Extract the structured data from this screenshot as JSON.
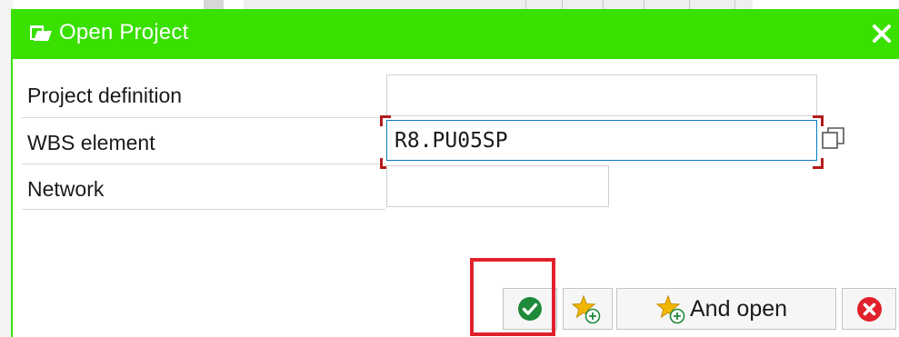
{
  "dialog": {
    "title": "Open Project",
    "title_icon": "open-folder-icon",
    "close_icon": "close-icon"
  },
  "form": {
    "project_definition": {
      "label": "Project definition",
      "value": ""
    },
    "wbs_element": {
      "label": "WBS element",
      "value": "R8.PU05SP"
    },
    "network": {
      "label": "Network",
      "value": ""
    }
  },
  "buttons": {
    "confirm": {
      "icon": "checkmark-icon"
    },
    "add_favorite": {
      "icon": "star-add-icon"
    },
    "and_open": {
      "label": "And open",
      "icon": "star-add-icon"
    },
    "cancel": {
      "icon": "cancel-icon"
    }
  },
  "colors": {
    "titlebar": "#39e000",
    "confirm_green": "#1f8a3a",
    "cancel_red": "#e0212b",
    "highlight_red": "#e0212b",
    "focus_blue": "#0a7bc2",
    "star_gold": "#f2b705"
  }
}
